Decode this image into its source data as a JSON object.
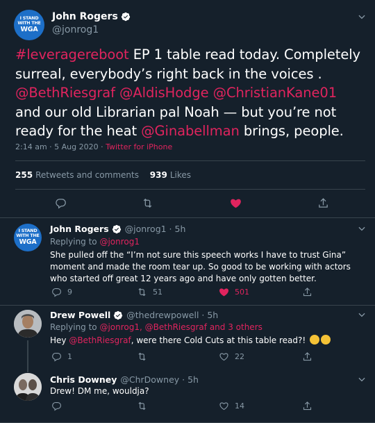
{
  "main_tweet": {
    "badge": {
      "line1": "I STAND",
      "line2": "WITH THE",
      "line3": "WGA"
    },
    "name": "John Rogers",
    "handle": "@jonrog1",
    "text": {
      "hashtag": "#leveragereboot",
      "part1": " EP 1 table read today. Completely surreal, everybody’s right back in the voices . ",
      "mention1": "@BethRiesgraf",
      "mention2": "@AldisHodge",
      "mention3": "@ChristianKane01",
      "part2": " and our old Librarian pal Noah — but you’re not ready for the heat ",
      "mention4": "@Ginabellman",
      "part3": " brings, people."
    },
    "timestamp": "2:14 am · 5 Aug 2020 · ",
    "source": "Twitter for iPhone",
    "retweets_count": "255",
    "retweets_label": "Retweets and comments",
    "likes_count": "939",
    "likes_label": "Likes"
  },
  "replies": [
    {
      "name": "John Rogers",
      "handle_time": "@jonrog1 · 5h",
      "replying_prefix": "Replying to ",
      "replying_to": "@jonrog1",
      "text": "She pulled off the “I’m not sure this speech works I have to trust Gina” moment and made the room tear up. So good to be working with actors who started off great 12 years ago and have only gotten better.",
      "replies": "9",
      "retweets": "51",
      "likes": "501",
      "liked": true
    },
    {
      "name": "Drew Powell",
      "handle_time": "@thedrewpowell · 5h",
      "replying_prefix": "Replying to ",
      "replying_to": "@jonrog1, @BethRiesgraf and 3 others",
      "text_pre": "Hey ",
      "text_mention": "@BethRiesgraf",
      "text_post": ", were there Cold Cuts at this table read?! ",
      "replies": "1",
      "retweets": "",
      "likes": "22",
      "liked": false
    },
    {
      "name": "Chris Downey",
      "handle_time": "@ChrDowney · 5h",
      "text": "Drew! DM me, wouldja?",
      "replies": "",
      "retweets": "",
      "likes": "14",
      "liked": false
    }
  ],
  "colors": {
    "background": "#15202b",
    "accent_link": "#e0245e",
    "muted": "#8899a6",
    "like_red": "#e0245e",
    "divider": "#38444d"
  },
  "icons": [
    "verified-badge-icon",
    "chevron-down-icon",
    "reply-icon",
    "retweet-icon",
    "heart-icon",
    "share-icon"
  ]
}
